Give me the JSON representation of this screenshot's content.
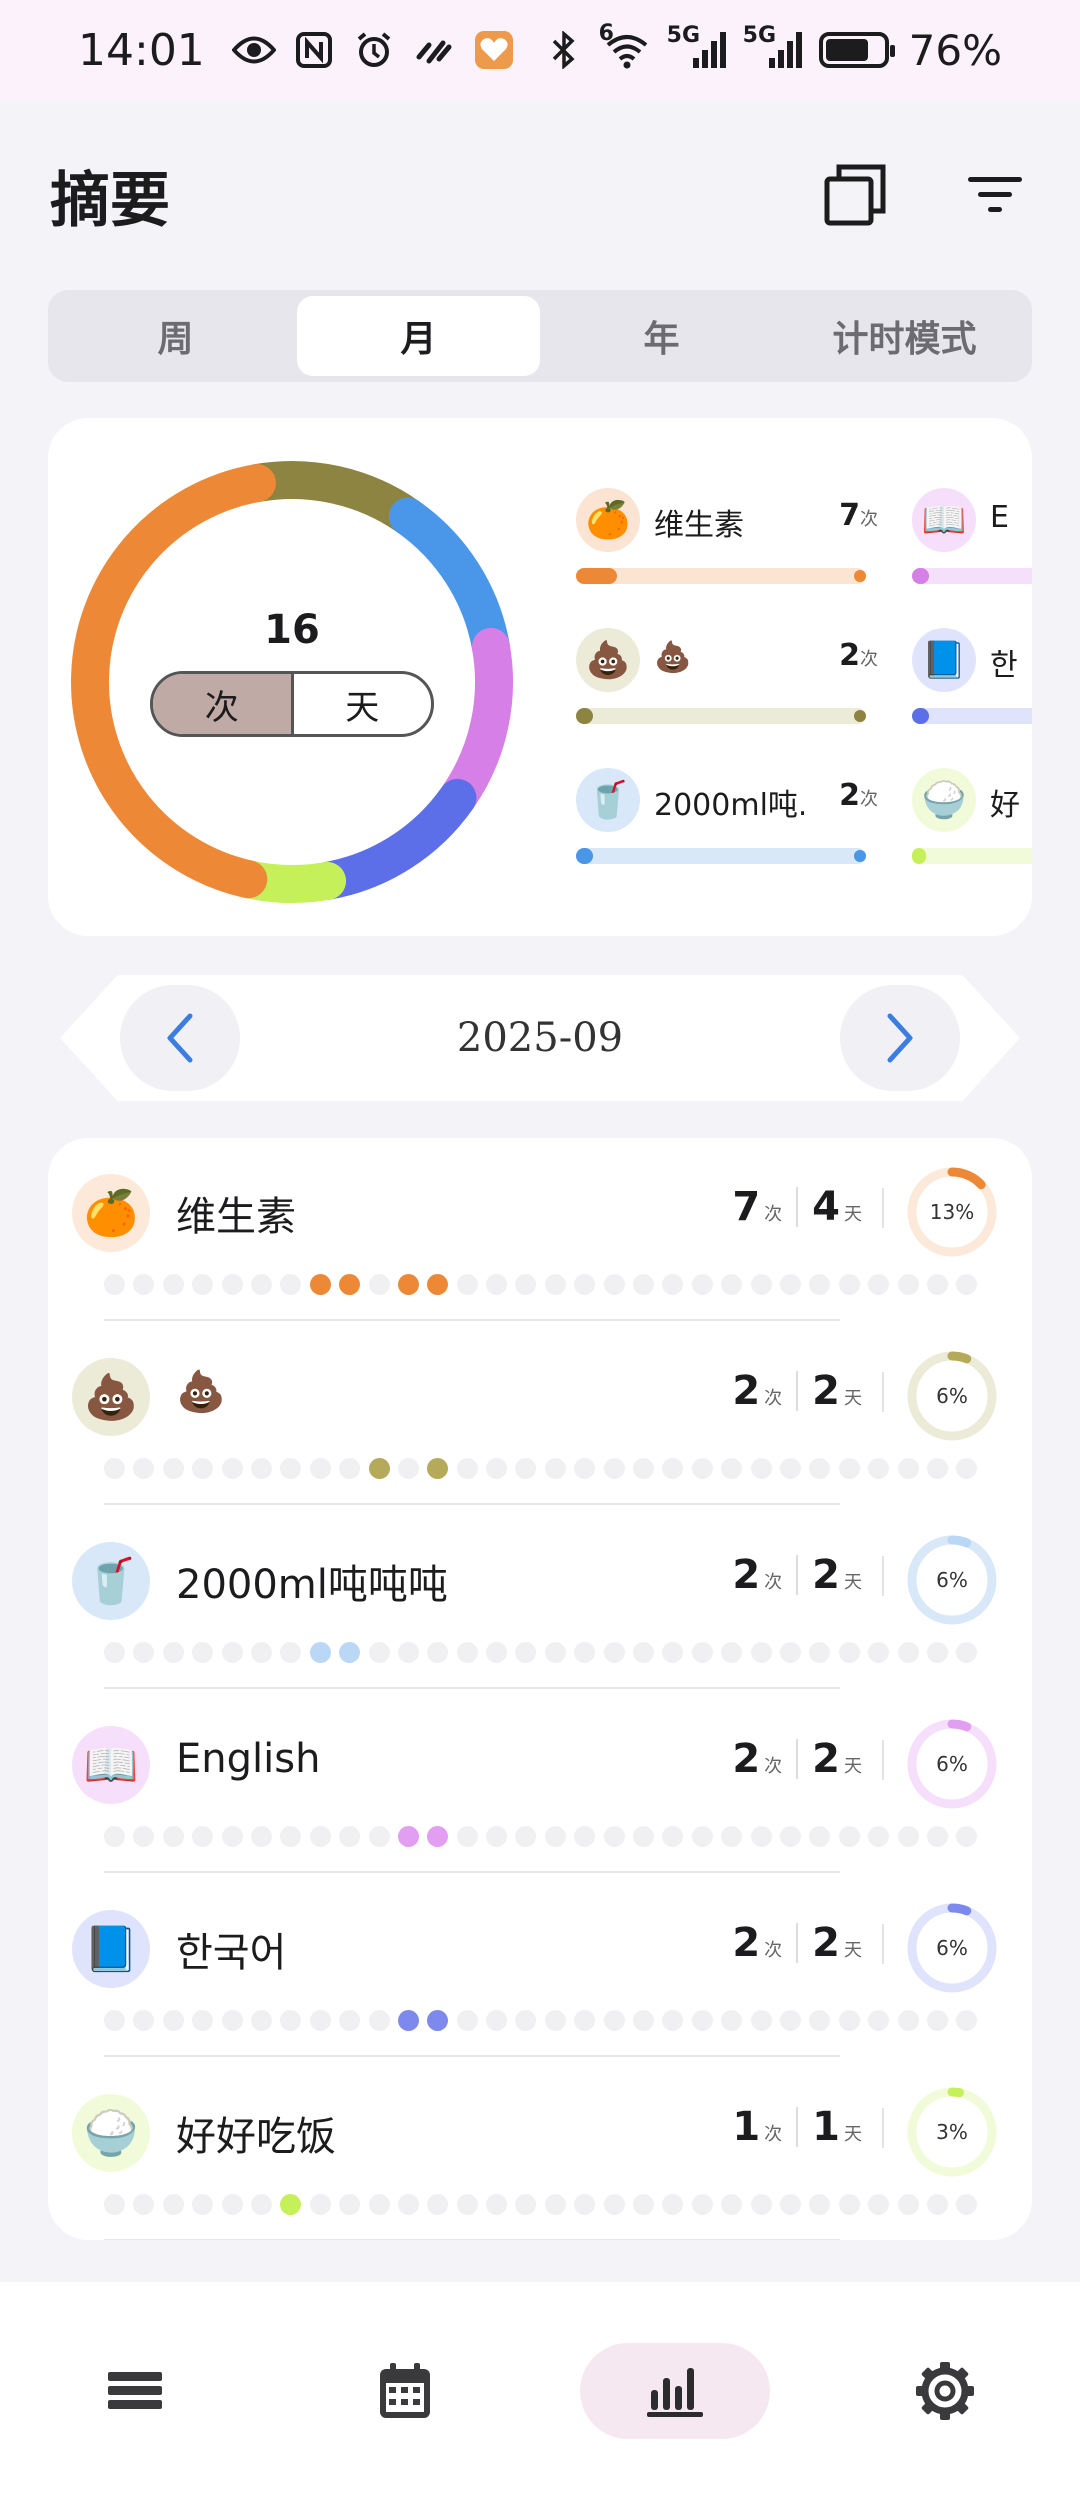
{
  "status_bar": {
    "time": "14:01",
    "left_icons": [
      "eye-icon",
      "nfc-icon",
      "alarm-icon",
      "link-icon",
      "health-app-icon"
    ],
    "right_icons": [
      "bluetooth-icon",
      "wifi-icon",
      "signal-5g-icon",
      "signal-5g-icon-2",
      "battery-icon"
    ],
    "wifi_label": "6",
    "signal1_label": "5G",
    "signal2_label": "5G",
    "battery_percent": "76%",
    "battery_level": 0.76
  },
  "header": {
    "title": "摘要",
    "actions": [
      "copy-view-icon",
      "filter-icon"
    ]
  },
  "period_tabs": [
    {
      "label": "周",
      "active": false
    },
    {
      "label": "月",
      "active": true
    },
    {
      "label": "年",
      "active": false
    },
    {
      "label": "计时模式",
      "active": false
    }
  ],
  "summary": {
    "total": "16",
    "unit_options": [
      {
        "label": "次",
        "selected": true
      },
      {
        "label": "天",
        "selected": false
      }
    ]
  },
  "legend": [
    {
      "emoji": "🍊",
      "name": "维生素",
      "count": "7",
      "unit": "次",
      "color": "#ed8936",
      "track": "#fbe4d2",
      "fill": 0.14
    },
    {
      "emoji": "📖",
      "name": "E",
      "count": "",
      "unit": "",
      "color": "#d67fe6",
      "track": "#f5dffa",
      "fill": 0.06
    },
    {
      "emoji": "💩",
      "name": "💩",
      "count": "2",
      "unit": "次",
      "color": "#8d8442",
      "track": "#ecebd8",
      "fill": 0.06
    },
    {
      "emoji": "📘",
      "name": "한",
      "count": "",
      "unit": "",
      "color": "#5d6fe8",
      "track": "#dfe3fb",
      "fill": 0.06
    },
    {
      "emoji": "🥤",
      "name": "2000ml吨...",
      "count": "2",
      "unit": "次",
      "color": "#4a96e8",
      "track": "#d8e8f8",
      "fill": 0.06
    },
    {
      "emoji": "🍚",
      "name": "好",
      "count": "",
      "unit": "",
      "color": "#c6f05a",
      "track": "#f1fbd9",
      "fill": 0.03
    }
  ],
  "chart_data": {
    "type": "pie",
    "title": "",
    "categories": [
      "维生素",
      "💩",
      "2000ml吨吨吨",
      "English",
      "한국어",
      "好好吃饭"
    ],
    "values": [
      7,
      2,
      2,
      2,
      2,
      1
    ],
    "colors": [
      "#ed8936",
      "#8d8442",
      "#4a96e8",
      "#d67fe6",
      "#5d6fe8",
      "#c6f05a"
    ]
  },
  "date_nav": {
    "label": "2025-09",
    "prev_icon": "chevron-left-icon",
    "next_icon": "chevron-right-icon"
  },
  "habits": [
    {
      "emoji": "🍊",
      "name": "维生素",
      "times": "7",
      "times_unit": "次",
      "days": "4",
      "days_unit": "天",
      "percent": "13%",
      "ratio": 0.13,
      "color": "#ed8936",
      "soft": "#fde9d9",
      "marked_days": [
        8,
        9,
        11,
        12
      ]
    },
    {
      "emoji": "💩",
      "name": "💩",
      "times": "2",
      "times_unit": "次",
      "days": "2",
      "days_unit": "天",
      "percent": "6%",
      "ratio": 0.06,
      "color": "#b5aa5a",
      "soft": "#ecebd8",
      "marked_days": [
        10,
        12
      ]
    },
    {
      "emoji": "🥤",
      "name": "2000ml吨吨吨",
      "times": "2",
      "times_unit": "次",
      "days": "2",
      "days_unit": "天",
      "percent": "6%",
      "ratio": 0.06,
      "color": "#bad8f5",
      "soft": "#d8e8f8",
      "marked_days": [
        8,
        9
      ]
    },
    {
      "emoji": "📖",
      "name": "English",
      "times": "2",
      "times_unit": "次",
      "days": "2",
      "days_unit": "天",
      "percent": "6%",
      "ratio": 0.06,
      "color": "#e29ef0",
      "soft": "#f5dffa",
      "marked_days": [
        11,
        12
      ]
    },
    {
      "emoji": "📘",
      "name": "한국어",
      "times": "2",
      "times_unit": "次",
      "days": "2",
      "days_unit": "天",
      "percent": "6%",
      "ratio": 0.06,
      "color": "#7d89ec",
      "soft": "#dfe3fb",
      "marked_days": [
        11,
        12
      ]
    },
    {
      "emoji": "🍚",
      "name": "好好吃饭",
      "times": "1",
      "times_unit": "次",
      "days": "1",
      "days_unit": "天",
      "percent": "3%",
      "ratio": 0.03,
      "color": "#c6f05a",
      "soft": "#f1fbd9",
      "marked_days": [
        7
      ]
    }
  ],
  "days_in_month": 30,
  "bottom_nav": [
    {
      "icon": "list-icon",
      "active": false
    },
    {
      "icon": "calendar-icon",
      "active": false
    },
    {
      "icon": "bar-chart-icon",
      "active": true
    },
    {
      "icon": "settings-gear-icon",
      "active": false
    }
  ]
}
